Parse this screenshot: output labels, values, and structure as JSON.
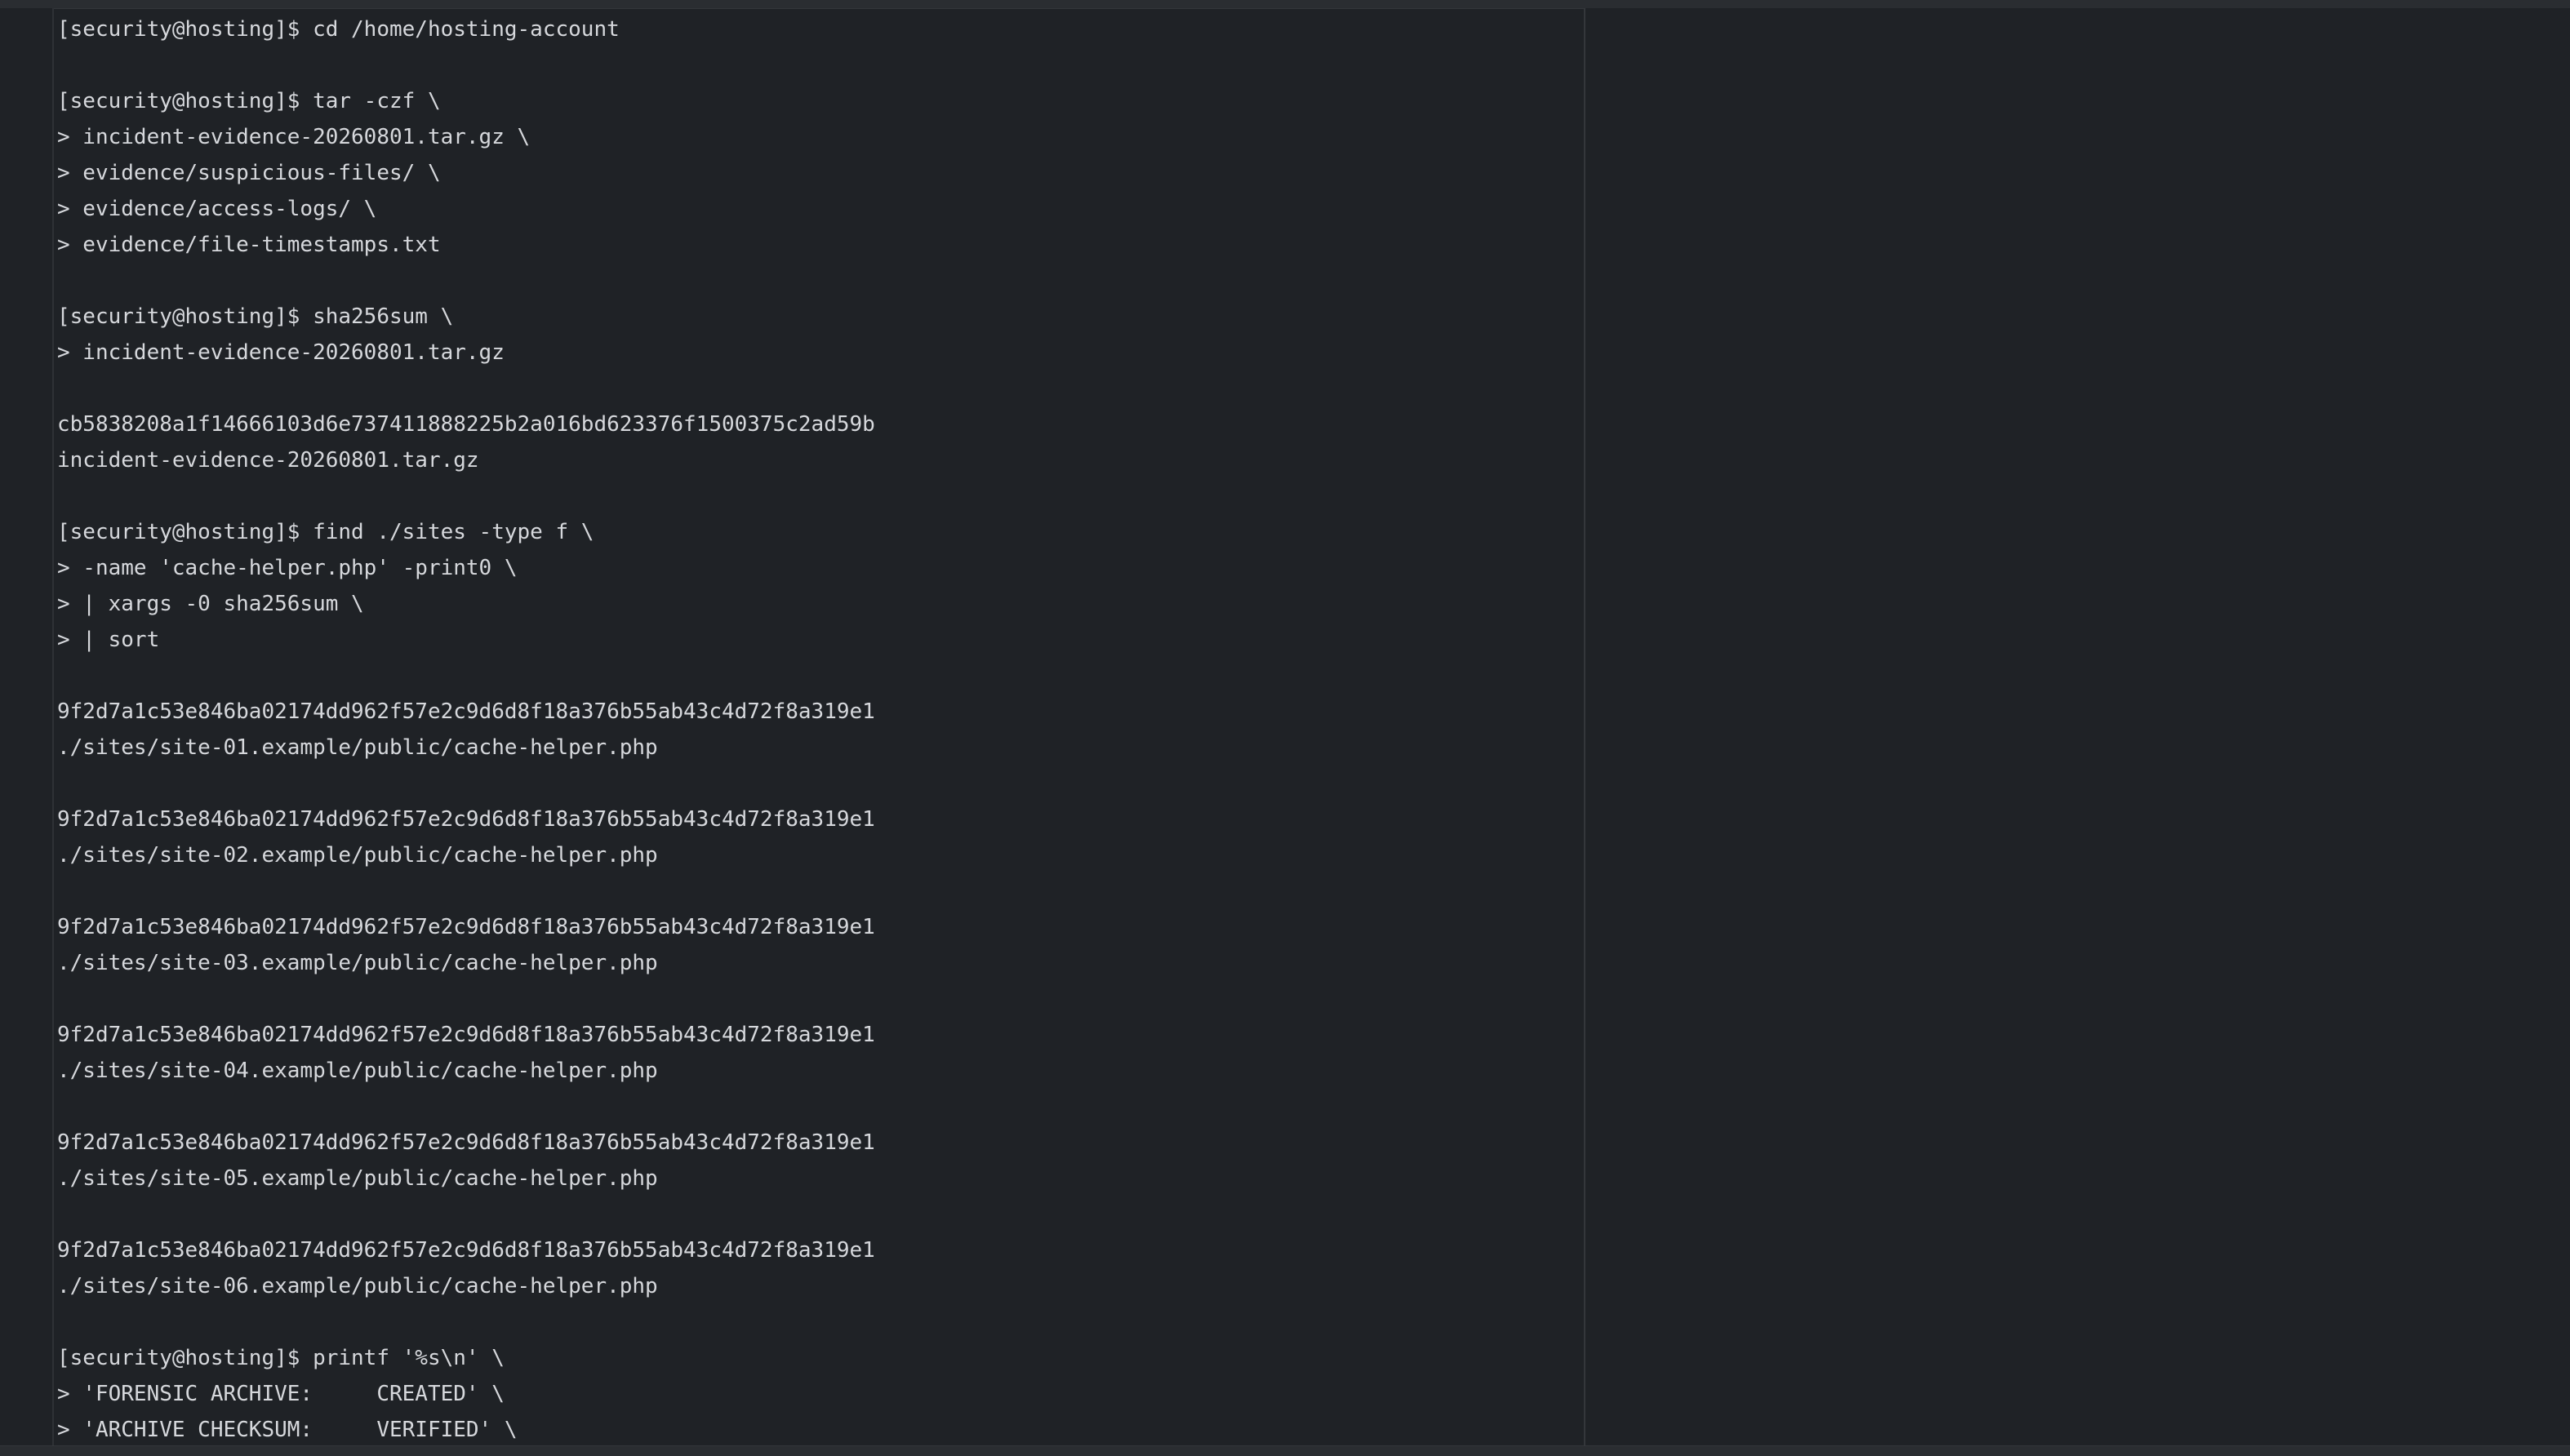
{
  "terminal": {
    "lines": [
      "[security@hosting]$ cd /home/hosting-account",
      "",
      "[security@hosting]$ tar -czf \\",
      "> incident-evidence-20260801.tar.gz \\",
      "> evidence/suspicious-files/ \\",
      "> evidence/access-logs/ \\",
      "> evidence/file-timestamps.txt",
      "",
      "[security@hosting]$ sha256sum \\",
      "> incident-evidence-20260801.tar.gz",
      "",
      "cb5838208a1f14666103d6e737411888225b2a016bd623376f1500375c2ad59b",
      "incident-evidence-20260801.tar.gz",
      "",
      "[security@hosting]$ find ./sites -type f \\",
      "> -name 'cache-helper.php' -print0 \\",
      "> | xargs -0 sha256sum \\",
      "> | sort",
      "",
      "9f2d7a1c53e846ba02174dd962f57e2c9d6d8f18a376b55ab43c4d72f8a319e1",
      "./sites/site-01.example/public/cache-helper.php",
      "",
      "9f2d7a1c53e846ba02174dd962f57e2c9d6d8f18a376b55ab43c4d72f8a319e1",
      "./sites/site-02.example/public/cache-helper.php",
      "",
      "9f2d7a1c53e846ba02174dd962f57e2c9d6d8f18a376b55ab43c4d72f8a319e1",
      "./sites/site-03.example/public/cache-helper.php",
      "",
      "9f2d7a1c53e846ba02174dd962f57e2c9d6d8f18a376b55ab43c4d72f8a319e1",
      "./sites/site-04.example/public/cache-helper.php",
      "",
      "9f2d7a1c53e846ba02174dd962f57e2c9d6d8f18a376b55ab43c4d72f8a319e1",
      "./sites/site-05.example/public/cache-helper.php",
      "",
      "9f2d7a1c53e846ba02174dd962f57e2c9d6d8f18a376b55ab43c4d72f8a319e1",
      "./sites/site-06.example/public/cache-helper.php",
      "",
      "[security@hosting]$ printf '%s\\n' \\",
      "> 'FORENSIC ARCHIVE:     CREATED' \\",
      "> 'ARCHIVE CHECKSUM:     VERIFIED' \\"
    ]
  },
  "colors": {
    "background": "#1f2226",
    "text": "#d6d8dc",
    "divider": "#34373b"
  }
}
